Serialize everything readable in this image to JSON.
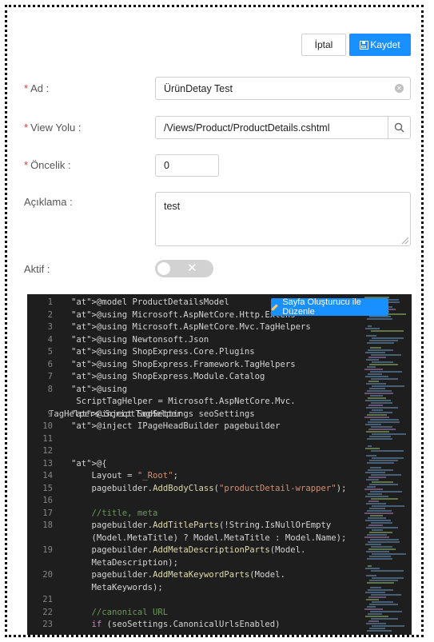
{
  "toolbar": {
    "cancel_label": "İptal",
    "save_label": "Kaydet"
  },
  "form": {
    "ad": {
      "label": "Ad",
      "value": "ÜrünDetay Test"
    },
    "view_yolu": {
      "label": "View Yolu",
      "value": "/Views/Product/ProductDetails.cshtml"
    },
    "oncelik": {
      "label": "Öncelik",
      "value": "0"
    },
    "aciklama": {
      "label": "Açıklama",
      "value": "test"
    },
    "aktif": {
      "label": "Aktif",
      "enabled": false
    }
  },
  "editor": {
    "edit_button_label": "Sayfa Oluşturucu ile Düzenle",
    "lines": [
      {
        "n": "1",
        "text": "@model ProductDetailsModel"
      },
      {
        "n": "2",
        "text": "@using Microsoft.AspNetCore.Http.Extens"
      },
      {
        "n": "3",
        "text": "@using Microsoft.AspNetCore.Mvc.TagHelpers"
      },
      {
        "n": "4",
        "text": "@using Newtonsoft.Json"
      },
      {
        "n": "5",
        "text": "@using ShopExpress.Core.Plugins"
      },
      {
        "n": "6",
        "text": "@using ShopExpress.Framework.TagHelpers"
      },
      {
        "n": "7",
        "text": "@using ShopExpress.Module.Catalog"
      },
      {
        "n": "8",
        "text": "@using ScriptTagHelper = Microsoft.AspNetCore.Mvc.",
        "wrap": "TagHelpers.ScriptTagHelper"
      },
      {
        "n": "9",
        "text": "@inject SeoSettings seoSettings"
      },
      {
        "n": "10",
        "text": "@inject IPageHeadBuilder pagebuilder"
      },
      {
        "n": "11",
        "text": ""
      },
      {
        "n": "12",
        "text": ""
      },
      {
        "n": "13",
        "text": "@{"
      },
      {
        "n": "14",
        "text": "    Layout = \"_Root\";"
      },
      {
        "n": "15",
        "text": "    pagebuilder.AddBodyClass(\"productDetail-wrapper\");"
      },
      {
        "n": "16",
        "text": ""
      },
      {
        "n": "17",
        "text": "    //title, meta"
      },
      {
        "n": "18",
        "text": "    pagebuilder.AddTitleParts(!String.IsNullOrEmpty",
        "wrap": "    (Model.MetaTitle) ? Model.MetaTitle : Model.Name);"
      },
      {
        "n": "19",
        "text": "    pagebuilder.AddMetaDescriptionParts(Model.",
        "wrap": "    MetaDescription);"
      },
      {
        "n": "20",
        "text": "    pagebuilder.AddMetaKeywordParts(Model.",
        "wrap": "    MetaKeywords);"
      },
      {
        "n": "21",
        "text": ""
      },
      {
        "n": "22",
        "text": "    //canonical URL"
      },
      {
        "n": "23",
        "text": "    if (seoSettings.CanonicalUrlsEnabled)"
      }
    ]
  }
}
